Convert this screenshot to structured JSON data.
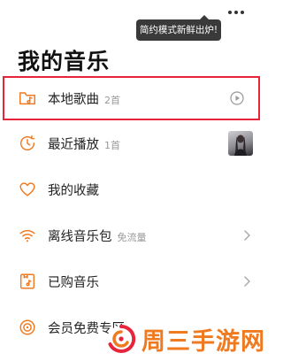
{
  "header": {
    "title": "我的音乐",
    "tooltip": "简约模式新鲜出炉!"
  },
  "menu": {
    "items": [
      {
        "label": "本地歌曲",
        "count": "2首",
        "icon": "folder-music-icon",
        "right": "play-circle-icon",
        "selected": true
      },
      {
        "label": "最近播放",
        "count": "1首",
        "icon": "recent-clock-icon",
        "right": "album-thumbnail"
      },
      {
        "label": "我的收藏",
        "count": "",
        "icon": "heart-icon",
        "right": ""
      },
      {
        "label": "离线音乐包",
        "count": "免流量",
        "icon": "wifi-icon",
        "right": "chevron-right-icon"
      },
      {
        "label": "已购音乐",
        "count": "",
        "icon": "purchased-music-icon",
        "right": "chevron-right-icon"
      },
      {
        "label": "会员免费专区",
        "count": "",
        "icon": "vinyl-disc-icon",
        "right": ""
      }
    ]
  },
  "watermark": {
    "text": "周三手游网"
  },
  "colors": {
    "accent": "#f07a20",
    "selection_border": "#e8243a",
    "tooltip_bg": "#3a3a3a"
  }
}
